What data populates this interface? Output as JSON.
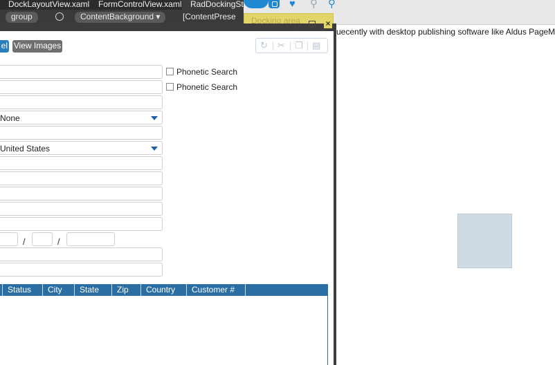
{
  "tabs": [
    {
      "label": "DockLayoutView.xaml"
    },
    {
      "label": "FormControlView.xaml"
    },
    {
      "label": "RadDockingSty"
    }
  ],
  "breadcrumbs": [
    {
      "label": "group"
    },
    {
      "label": "ContentBackground ▾"
    },
    {
      "label": "[ContentPrese"
    }
  ],
  "dock_target": {
    "label": "Docking area"
  },
  "toolbar": {
    "partial_button_label": "el",
    "view_images_label": "View Images",
    "icons": [
      "refresh-icon",
      "cut-icon",
      "copy-icon",
      "paste-icon"
    ]
  },
  "form": {
    "phonetic_label_1": "Phonetic Search",
    "phonetic_label_2": "Phonetic Search",
    "dropdown_1_value": "None",
    "dropdown_2_value": "United States",
    "date_separator": "/"
  },
  "grid": {
    "columns": [
      "Status",
      "City",
      "State",
      "Zip",
      "Country",
      "Customer #"
    ]
  },
  "document": {
    "text": "uecently with desktop publishing software like Aldus PageMaker including versions of Lorem Ipsum."
  },
  "colors": {
    "accent": "#2b6ea3",
    "dock_highlight": "#e2d563",
    "frame": "#3c3c3c"
  }
}
